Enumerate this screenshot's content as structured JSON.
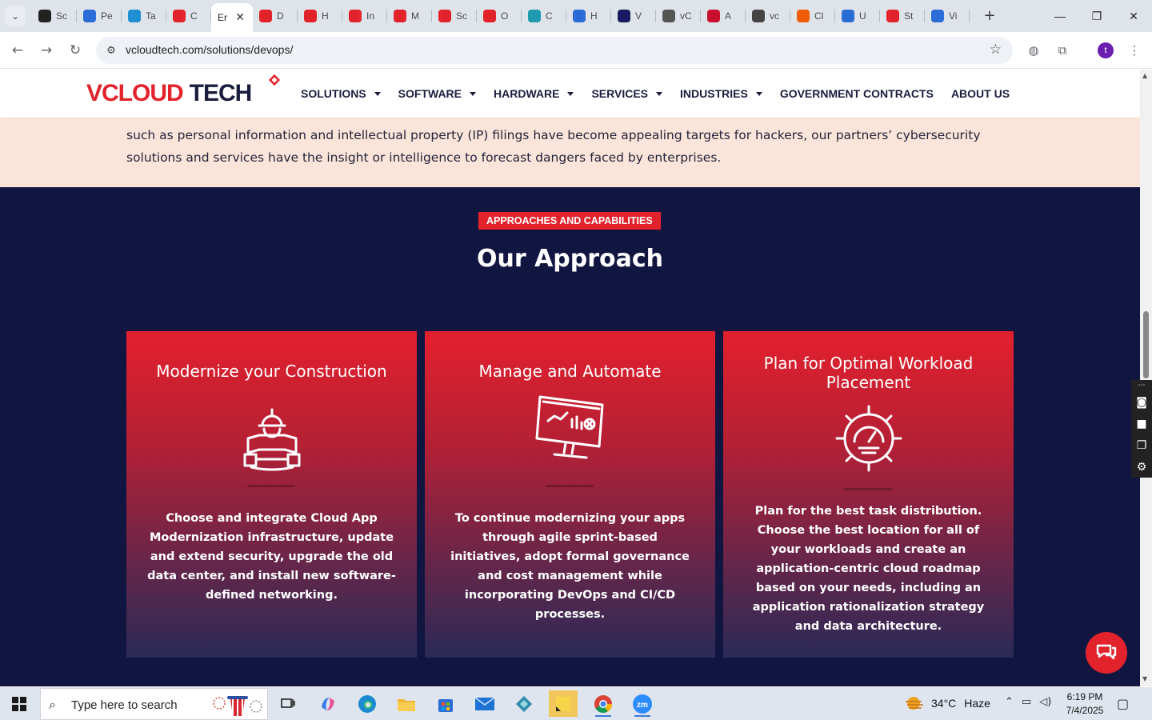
{
  "browser": {
    "tabs": [
      {
        "label": "Sc",
        "fav_color": "#222222"
      },
      {
        "label": "Pe",
        "fav_color": "#2b6cd6"
      },
      {
        "label": "Ta",
        "fav_color": "#1f8fd1"
      },
      {
        "label": "C",
        "fav_color": "#e3232c"
      },
      {
        "label": "Er",
        "fav_color": "#ffffff",
        "active": true
      },
      {
        "label": "D",
        "fav_color": "#e3232c"
      },
      {
        "label": "H",
        "fav_color": "#e3232c"
      },
      {
        "label": "In",
        "fav_color": "#e3232c"
      },
      {
        "label": "M",
        "fav_color": "#e3232c"
      },
      {
        "label": "Sc",
        "fav_color": "#e3232c"
      },
      {
        "label": "O",
        "fav_color": "#e3232c"
      },
      {
        "label": "C",
        "fav_color": "#1e9bb0"
      },
      {
        "label": "H",
        "fav_color": "#2b6cd6"
      },
      {
        "label": "V",
        "fav_color": "#1a1a60"
      },
      {
        "label": "vC",
        "fav_color": "#555555"
      },
      {
        "label": "A",
        "fav_color": "#c8102e"
      },
      {
        "label": "vc",
        "fav_color": "#444444"
      },
      {
        "label": "Cl",
        "fav_color": "#f25c05"
      },
      {
        "label": "U",
        "fav_color": "#2b6cd6"
      },
      {
        "label": "St",
        "fav_color": "#e3232c"
      },
      {
        "label": "Vi",
        "fav_color": "#2b6cd6"
      }
    ],
    "close_symbol": "✕",
    "new_tab": "+",
    "url": "vcloudtech.com/solutions/devops/",
    "profile_initial": "t"
  },
  "site": {
    "logo": {
      "v": "V",
      "cloud": "CLOUD",
      "tech": "TECH"
    },
    "menu": [
      {
        "label": "SOLUTIONS",
        "dropdown": true
      },
      {
        "label": "SOFTWARE",
        "dropdown": true
      },
      {
        "label": "HARDWARE",
        "dropdown": true
      },
      {
        "label": "SERVICES",
        "dropdown": true
      },
      {
        "label": "INDUSTRIES",
        "dropdown": true
      },
      {
        "label": "GOVERNMENT CONTRACTS",
        "dropdown": false
      },
      {
        "label": "ABOUT US",
        "dropdown": false
      }
    ],
    "intro_text": "such as personal information and intellectual property (IP) filings have become appealing targets for hackers, our partners’ cybersecurity solutions and services have the insight or intelligence to forecast dangers faced by enterprises.",
    "section": {
      "eyebrow": "APPROACHES AND CAPABILITIES",
      "heading": "Our Approach",
      "cards": [
        {
          "title": "Modernize your Construction",
          "icon": "engineer-blueprint-icon",
          "text": "Choose and integrate Cloud App Modernization infrastructure, update and extend security, upgrade the old data center, and install new software-defined networking."
        },
        {
          "title": "Manage and Automate",
          "icon": "monitor-analytics-icon",
          "text": "To continue modernizing your apps through agile sprint-based initiatives, adopt formal governance and cost management while incorporating DevOps and CI/CD processes."
        },
        {
          "title": "Plan for Optimal Workload Placement",
          "icon": "gear-gauge-icon",
          "text": "Plan for the best task distribution. Choose the best location for all of your workloads and create an application-centric cloud roadmap based on your needs, including an application rationalization strategy and data architecture."
        }
      ]
    },
    "colors": {
      "accent": "#e3232c",
      "navy": "#111641",
      "peach": "#fbe5da"
    }
  },
  "taskbar": {
    "search_placeholder": "Type here to search",
    "weather": {
      "temp": "34°C",
      "condition": "Haze"
    },
    "time": "6:19 PM",
    "date": "7/4/2025"
  }
}
